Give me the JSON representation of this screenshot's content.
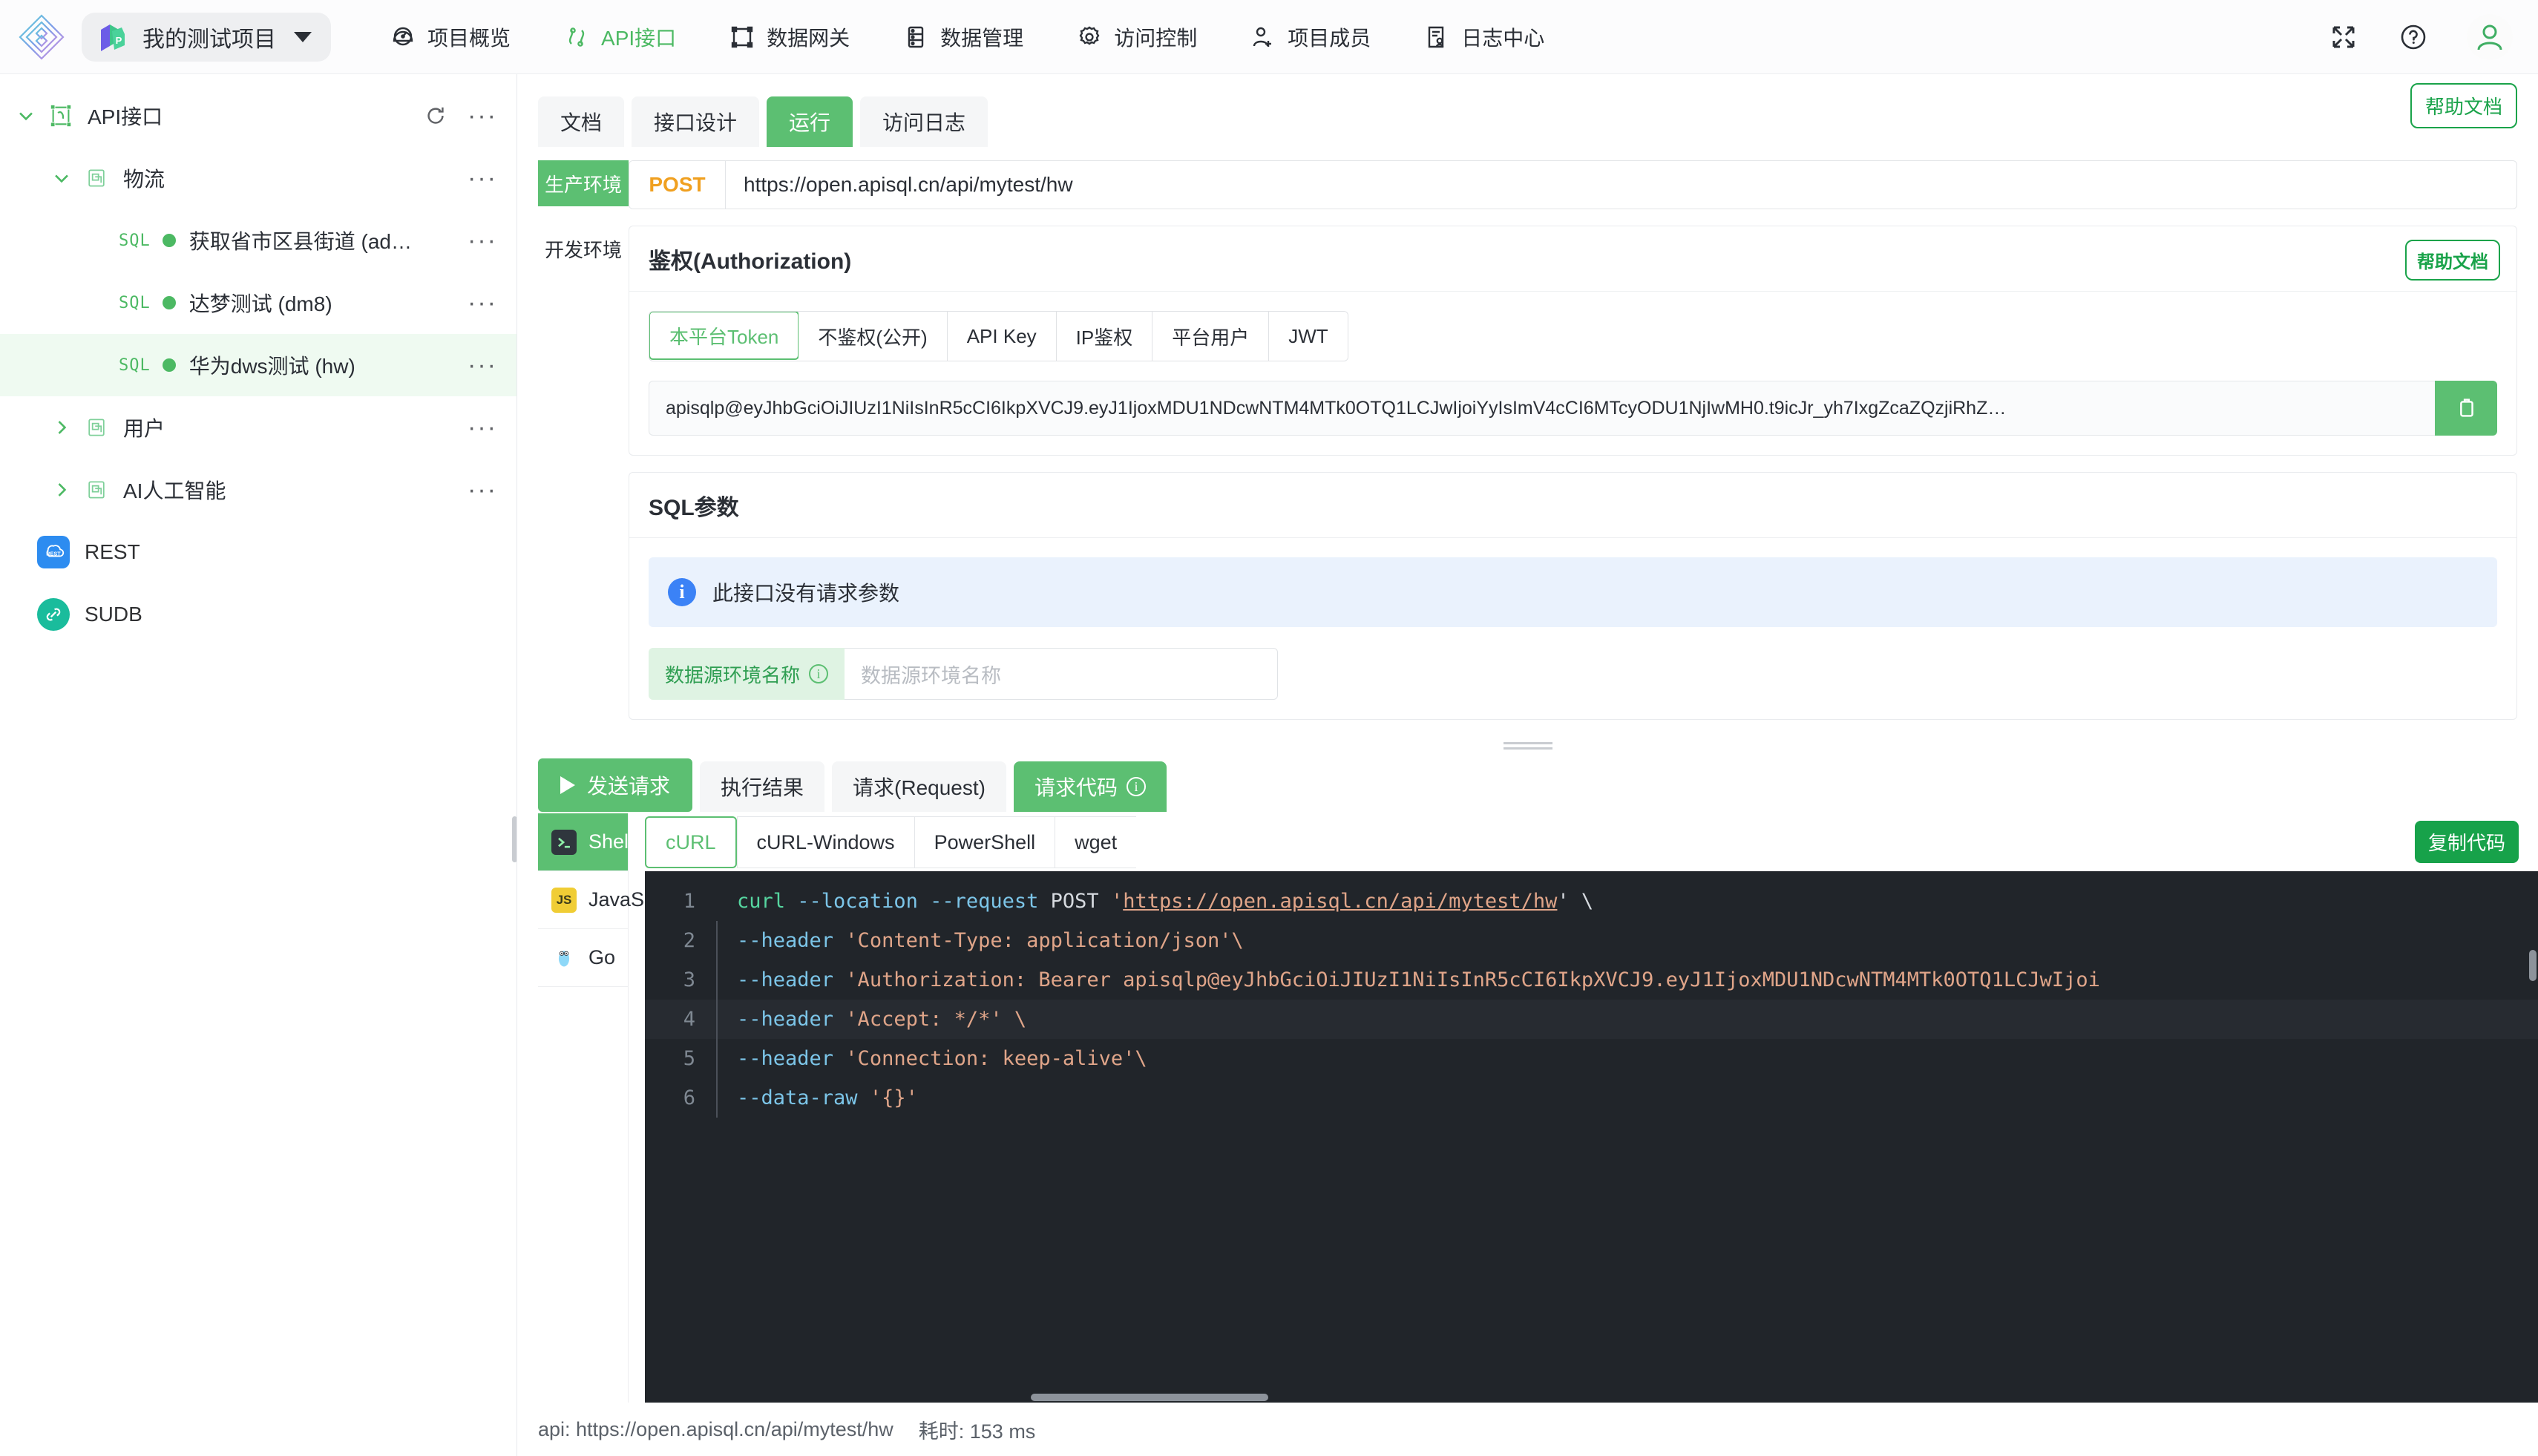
{
  "topbar": {
    "project_name": "我的测试项目",
    "project_badge_letter": "P",
    "nav": [
      {
        "label": "项目概览",
        "icon": "dashboard-icon",
        "active": false
      },
      {
        "label": "API接口",
        "icon": "api-icon",
        "active": true
      },
      {
        "label": "数据网关",
        "icon": "gateway-icon",
        "active": false
      },
      {
        "label": "数据管理",
        "icon": "database-icon",
        "active": false
      },
      {
        "label": "访问控制",
        "icon": "gear-icon",
        "active": false
      },
      {
        "label": "项目成员",
        "icon": "user-add-icon",
        "active": false
      },
      {
        "label": "日志中心",
        "icon": "log-icon",
        "active": false
      }
    ],
    "right_icons": [
      "fullscreen-icon",
      "question-circle-icon",
      "avatar-icon"
    ]
  },
  "sidebar": {
    "root": {
      "label": "API接口",
      "expanded": true
    },
    "groups": [
      {
        "label": "物流",
        "expanded": true,
        "children": [
          {
            "label": "获取省市区县街道 (ad…",
            "tag": "SQL",
            "status": "online",
            "selected": false
          },
          {
            "label": "达梦测试 (dm8)",
            "tag": "SQL",
            "status": "online",
            "selected": false
          },
          {
            "label": "华为dws测试 (hw)",
            "tag": "SQL",
            "status": "online",
            "selected": true
          }
        ]
      },
      {
        "label": "用户",
        "expanded": false,
        "children": []
      },
      {
        "label": "AI人工智能",
        "expanded": false,
        "children": []
      }
    ],
    "flat_items": [
      {
        "label": "REST",
        "icon": "rest-icon",
        "color": "#2d8cf0"
      },
      {
        "label": "SUDB",
        "icon": "link-icon",
        "color": "#1abc9c"
      }
    ],
    "more_label": "···",
    "refresh_label": "refresh"
  },
  "main": {
    "tabs": [
      {
        "label": "文档",
        "active": false
      },
      {
        "label": "接口设计",
        "active": false
      },
      {
        "label": "运行",
        "active": true
      },
      {
        "label": "访问日志",
        "active": false
      }
    ],
    "help_doc_label": "帮助文档",
    "environments": [
      {
        "label": "生产环境",
        "active": true
      },
      {
        "label": "开发环境",
        "active": false
      }
    ],
    "request": {
      "method": "POST",
      "url": "https://open.apisql.cn/api/mytest/hw"
    },
    "auth": {
      "title": "鉴权(Authorization)",
      "help_doc_label": "帮助文档",
      "tabs": [
        {
          "label": "本平台Token",
          "active": true
        },
        {
          "label": "不鉴权(公开)",
          "active": false
        },
        {
          "label": "API Key",
          "active": false
        },
        {
          "label": "IP鉴权",
          "active": false
        },
        {
          "label": "平台用户",
          "active": false
        },
        {
          "label": "JWT",
          "active": false
        }
      ],
      "token": "apisqlp@eyJhbGciOiJIUzI1NiIsInR5cCI6IkpXVCJ9.eyJ1IjoxMDU1NDcwNTM4MTk0OTQ1LCJwIjoiYyIsImV4cCI6MTcyODU1NjIwMH0.t9icJr_yh7IxgZcaZQzjiRhZ…",
      "copy_icon": "copy-icon"
    },
    "sql_params": {
      "title": "SQL参数",
      "info_icon": "info-icon",
      "info_text": "此接口没有请求参数",
      "ds_label": "数据源环境名称",
      "ds_label_info_icon": "info-circle-icon",
      "ds_placeholder": "数据源环境名称",
      "ds_value": ""
    },
    "result": {
      "send_label": "发送请求",
      "send_icon": "play-icon",
      "tabs": [
        {
          "label": "执行结果",
          "active": false,
          "info": false
        },
        {
          "label": "请求(Request)",
          "active": false,
          "info": false
        },
        {
          "label": "请求代码",
          "active": true,
          "info": true
        }
      ],
      "languages": [
        {
          "label": "Shell",
          "icon": "terminal-icon",
          "active": true
        },
        {
          "label": "JavaScript",
          "icon": "js-icon",
          "active": false
        },
        {
          "label": "Go",
          "icon": "go-icon",
          "active": false
        }
      ],
      "code_tabs": [
        {
          "label": "cURL",
          "active": true
        },
        {
          "label": "cURL-Windows",
          "active": false
        },
        {
          "label": "PowerShell",
          "active": false
        },
        {
          "label": "wget",
          "active": false
        }
      ],
      "copy_code_label": "复制代码",
      "code_lines": [
        {
          "no": "1",
          "cmd": "curl",
          "flag": " --location --request",
          "plain": " POST ",
          "quote": "'",
          "link": "https://open.apisql.cn/api/mytest/hw",
          "tail": "' \\"
        },
        {
          "no": "2",
          "flag": "--header",
          "str": " 'Content-Type: application/json'\\"
        },
        {
          "no": "3",
          "flag": "--header",
          "str": " 'Authorization: Bearer apisqlp@eyJhbGciOiJIUzI1NiIsInR5cCI6IkpXVCJ9.eyJ1IjoxMDU1NDcwNTM4MTk0OTQ1LCJwIjoi"
        },
        {
          "no": "4",
          "flag": "--header",
          "str": " 'Accept: */*' \\"
        },
        {
          "no": "5",
          "flag": "--header",
          "str": " 'Connection: keep-alive'\\"
        },
        {
          "no": "6",
          "flag": "--data-raw",
          "str": " '{}'"
        }
      ]
    },
    "status": {
      "api_text": "api: https://open.apisql.cn/api/mytest/hw",
      "time_text": "耗时: 153 ms"
    }
  }
}
